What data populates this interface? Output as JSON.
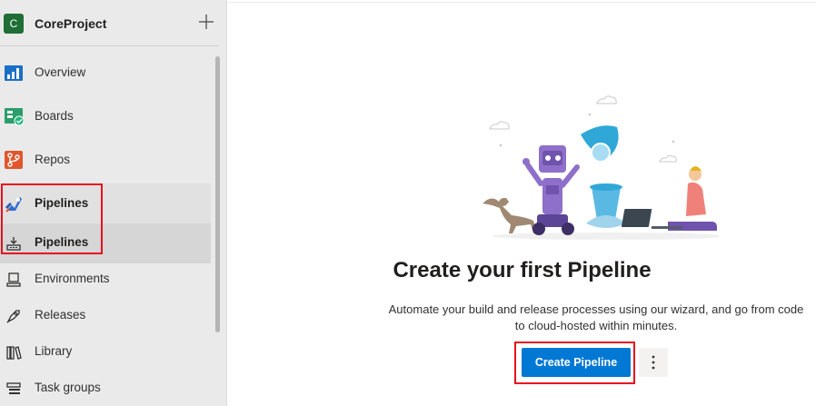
{
  "project": {
    "avatar_letter": "C",
    "name": "CoreProject",
    "avatar_color": "#1e6e35"
  },
  "sidebar": {
    "items": [
      {
        "label": "Overview",
        "icon": "overview-icon"
      },
      {
        "label": "Boards",
        "icon": "boards-icon"
      },
      {
        "label": "Repos",
        "icon": "repos-icon"
      },
      {
        "label": "Pipelines",
        "icon": "pipelines-icon"
      },
      {
        "label": "Pipelines",
        "icon": "pipelines-sub-icon"
      },
      {
        "label": "Environments",
        "icon": "environments-icon"
      },
      {
        "label": "Releases",
        "icon": "releases-icon"
      },
      {
        "label": "Library",
        "icon": "library-icon"
      },
      {
        "label": "Task groups",
        "icon": "task-groups-icon"
      }
    ]
  },
  "main": {
    "title": "Create your first Pipeline",
    "subtitle": "Automate your build and release processes using our wizard, and go from code to cloud-hosted within minutes.",
    "create_button": "Create Pipeline",
    "more_icon": "more-vertical-icon"
  },
  "colors": {
    "accent": "#0078d4",
    "highlight": "#e8101e"
  }
}
